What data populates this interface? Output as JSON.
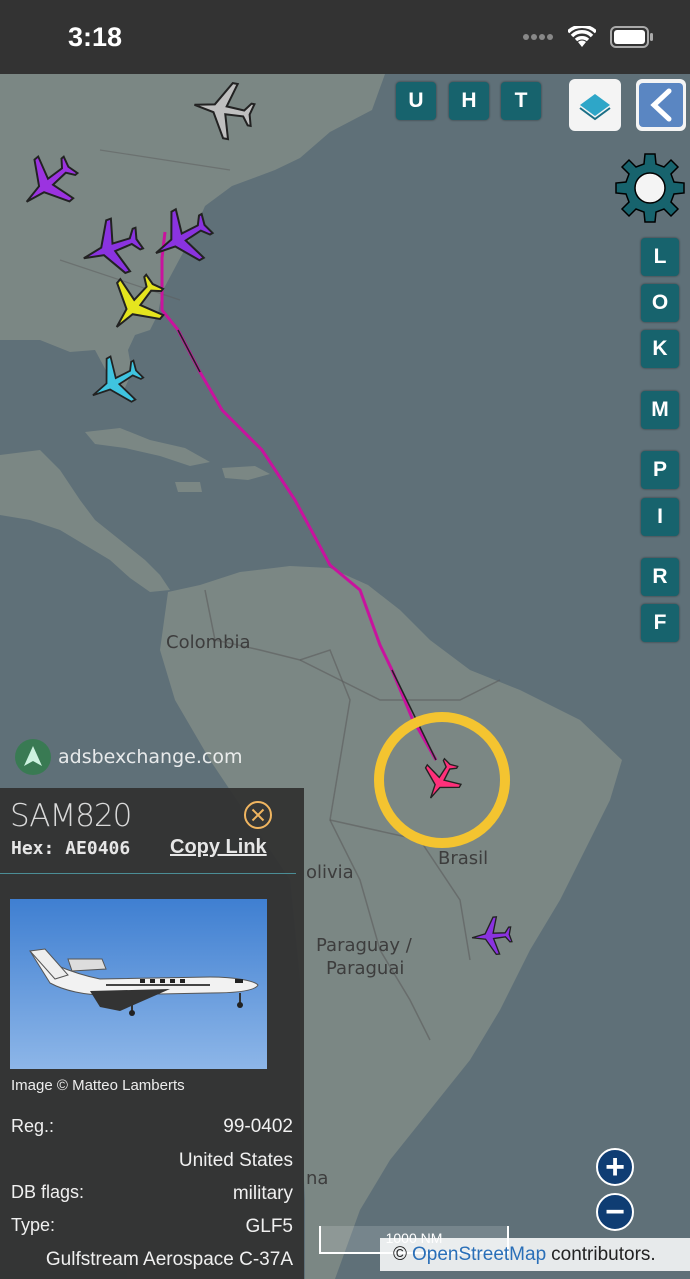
{
  "status_bar": {
    "time": "3:18"
  },
  "map": {
    "labels": {
      "colombia": "Colombia",
      "brasil": "Brasil",
      "bolivia": "olivia",
      "paraguay_1": "Paraguay /",
      "paraguay_2": "Paraguai",
      "argentina": "na"
    },
    "watermark": "adsbexchange.com",
    "scale": "1000 NM",
    "attribution": {
      "prefix": "©",
      "link": "OpenStreetMap",
      "suffix": "contributors."
    }
  },
  "toolbar": {
    "top_buttons": [
      "U",
      "H",
      "T"
    ],
    "side_buttons": [
      "L",
      "O",
      "K",
      "M",
      "P",
      "I",
      "R",
      "F"
    ]
  },
  "zoom": {
    "in": "+",
    "out": "−"
  },
  "aircraft_panel": {
    "callsign": "SAM820",
    "hex_label": "Hex:",
    "hex_value": "AE0406",
    "copy_link": "Copy Link",
    "image_credit": "Image © Matteo Lamberts",
    "rows": [
      {
        "label": "Reg.:",
        "value": "99-0402"
      },
      {
        "label": "",
        "value": "United States"
      },
      {
        "label": "DB flags:",
        "value": "military"
      },
      {
        "label": "Type:",
        "value": "GLF5"
      },
      {
        "label": "",
        "value": "Gulfstream Aerospace C-37A"
      }
    ]
  },
  "colors": {
    "button_teal": "#17636d",
    "track": "#c8139e",
    "selected_ring": "#f4c430",
    "selected_aircraft": "#ff2f7a",
    "zoom_button": "#0f3d73"
  }
}
